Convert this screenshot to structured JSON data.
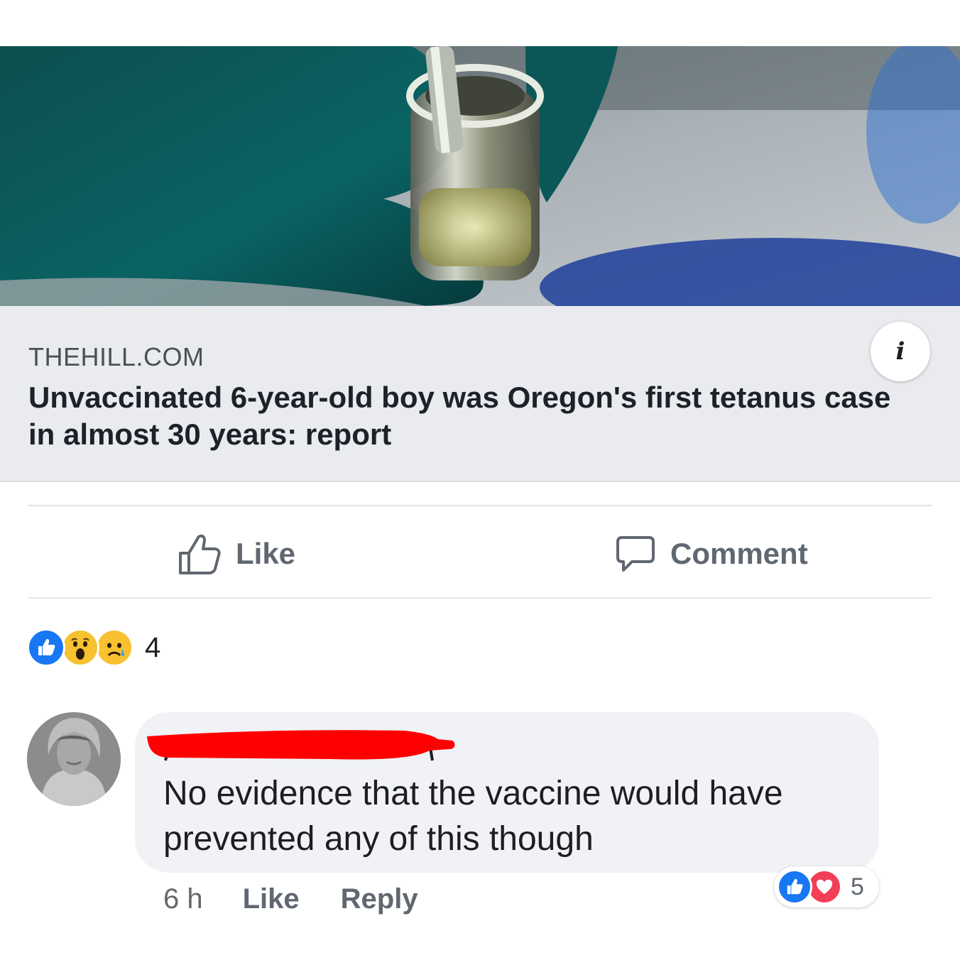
{
  "link_preview": {
    "domain": "THEHILL.COM",
    "title": "Unvaccinated 6-year-old boy was Oregon's first tetanus case in almost 30 years: report",
    "image_icon": "gloved-hand-holding-vaccine-vial",
    "info_icon": "info-icon",
    "info_glyph": "i"
  },
  "actions": {
    "like_label": "Like",
    "like_icon": "thumbs-up-outline-icon",
    "comment_label": "Comment",
    "comment_icon": "speech-bubble-icon"
  },
  "post_reactions": {
    "types": [
      "like",
      "wow",
      "sad"
    ],
    "count": "4"
  },
  "comment": {
    "author_name": "",
    "author_redacted": true,
    "text": "No evidence that the vaccine would have prevented any of this though",
    "time": "6 h",
    "like_label": "Like",
    "reply_label": "Reply",
    "reactions": {
      "types": [
        "like",
        "love"
      ],
      "count": "5"
    }
  },
  "colors": {
    "facebook_blue": "#1877f2",
    "love_red": "#f33e58",
    "reaction_yellow": "#f7c12f",
    "muted_text": "#606770",
    "meta_background": "#eaebef",
    "bubble_background": "#f0f2f5",
    "redaction_red": "#ff0000"
  }
}
